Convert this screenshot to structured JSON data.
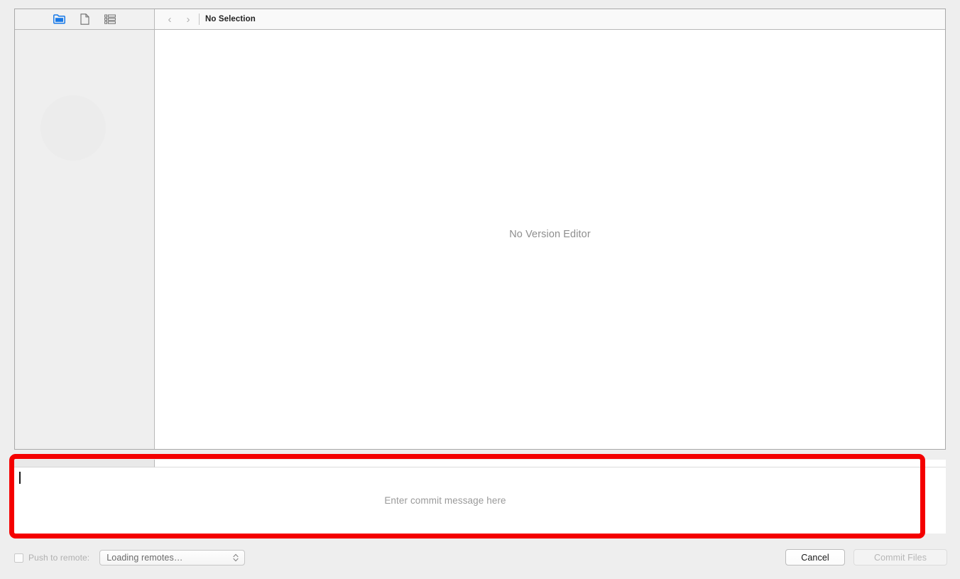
{
  "toolbar": {
    "icons": [
      {
        "name": "folder-icon",
        "label": "Project Navigator",
        "selected": true
      },
      {
        "name": "file-icon",
        "label": "Source Control File",
        "selected": false
      },
      {
        "name": "list-icon",
        "label": "Commit List",
        "selected": false
      }
    ],
    "nav": {
      "back_glyph": "‹",
      "forward_glyph": "›",
      "title": "No Selection"
    }
  },
  "editor": {
    "empty_message": "No Version Editor"
  },
  "commit": {
    "placeholder": "Enter commit message here",
    "value": ""
  },
  "footer": {
    "push_label": "Push to remote:",
    "push_checked": false,
    "remote_select": {
      "value": "Loading remotes…",
      "options": [
        "Loading remotes…"
      ]
    },
    "cancel_label": "Cancel",
    "commit_label": "Commit Files"
  },
  "annotation": {
    "color": "#f40000",
    "target": "commit-message-field"
  },
  "colors": {
    "accent": "#1779e8",
    "window_bg": "#ffffff",
    "chrome_bg": "#eeeeee",
    "sidebar_bg": "#efefef",
    "muted_text": "#8e8e8e"
  }
}
